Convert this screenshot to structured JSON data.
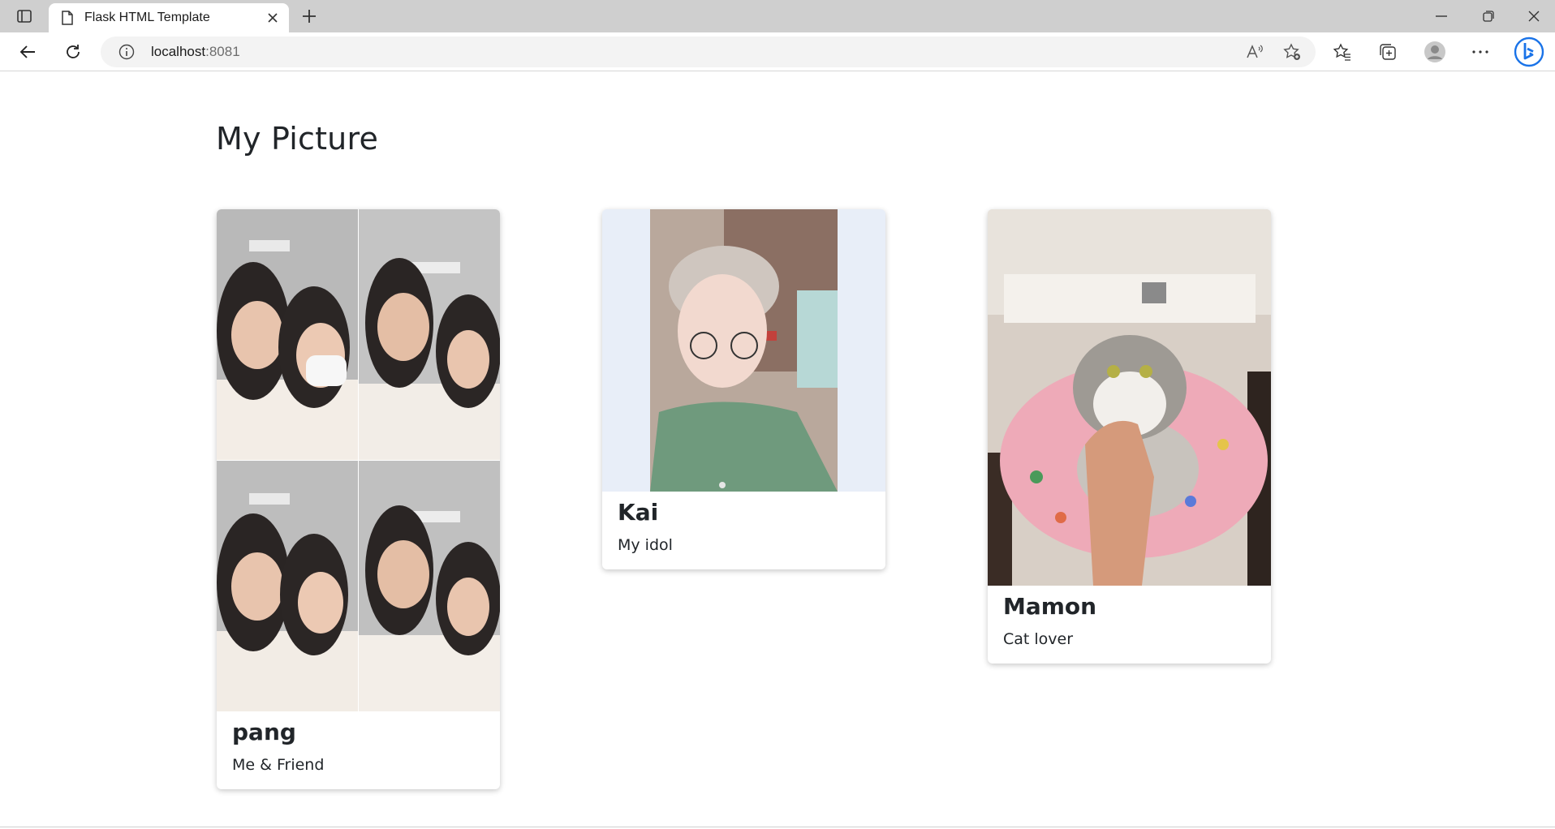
{
  "browser": {
    "tab_title": "Flask HTML Template",
    "url_host": "localhost",
    "url_port": ":8081"
  },
  "page": {
    "title": "My Picture",
    "cards": [
      {
        "name": "pang",
        "caption": "Me & Friend"
      },
      {
        "name": "Kai",
        "caption": "My idol"
      },
      {
        "name": "Mamon",
        "caption": "Cat lover"
      }
    ]
  },
  "colors": {
    "tabstrip": "#cfcfcf",
    "text": "#212529",
    "bing_blue": "#1a73e8"
  }
}
